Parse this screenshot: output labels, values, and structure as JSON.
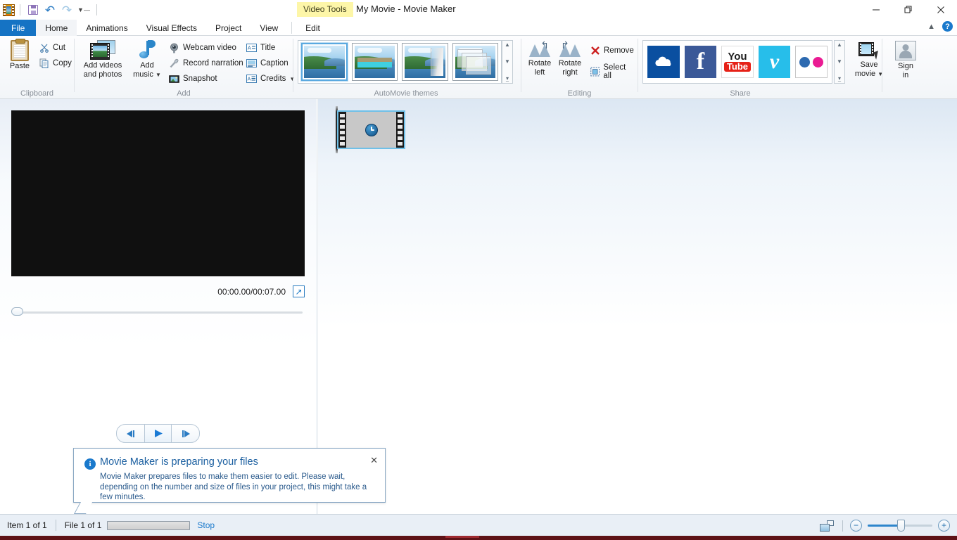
{
  "window": {
    "title": "My Movie - Movie Maker",
    "contextual_tab_label": "Video Tools",
    "minimize_icon": "minimize-icon",
    "maximize_icon": "restore-icon",
    "close_icon": "close-icon"
  },
  "quick_access": {
    "app_icon": "movie-maker-icon",
    "save_icon": "save-icon",
    "undo_icon": "undo-icon",
    "redo_icon": "redo-icon",
    "customize_icon": "chevron-down-icon"
  },
  "tabs": [
    {
      "label": "File",
      "state": "file"
    },
    {
      "label": "Home",
      "state": "active"
    },
    {
      "label": "Animations",
      "state": "normal"
    },
    {
      "label": "Visual Effects",
      "state": "normal"
    },
    {
      "label": "Project",
      "state": "normal"
    },
    {
      "label": "View",
      "state": "normal"
    },
    {
      "label": "Edit",
      "state": "contextual"
    }
  ],
  "ribbon_right": {
    "collapse_icon": "chevron-up-icon",
    "help_label": "?"
  },
  "ribbon": {
    "groups": [
      {
        "name": "Clipboard",
        "label": "Clipboard",
        "paste": {
          "label": "Paste",
          "icon": "paste-clipboard-icon"
        },
        "items": [
          {
            "label": "Cut",
            "icon": "cut-scissors-icon"
          },
          {
            "label": "Copy",
            "icon": "copy-icon"
          }
        ]
      },
      {
        "name": "Add",
        "label": "Add",
        "big_buttons": [
          {
            "label_line1": "Add videos",
            "label_line2": "and photos",
            "icon": "add-videos-and-photos-icon"
          },
          {
            "label_line1": "Add",
            "label_line2": "music",
            "icon": "add-music-icon",
            "has_dropdown": true
          }
        ],
        "small_items": [
          {
            "label": "Webcam video",
            "icon": "webcam-icon",
            "has_dropdown": false
          },
          {
            "label": "Record narration",
            "icon": "microphone-icon",
            "has_dropdown": true
          },
          {
            "label": "Snapshot",
            "icon": "snapshot-icon",
            "has_dropdown": false
          },
          {
            "label": "Title",
            "icon": "title-icon",
            "has_dropdown": false
          },
          {
            "label": "Caption",
            "icon": "caption-icon",
            "has_dropdown": false
          },
          {
            "label": "Credits",
            "icon": "credits-icon",
            "has_dropdown": true
          }
        ]
      },
      {
        "name": "AutoMovie themes",
        "label": "AutoMovie themes",
        "themes": [
          {
            "name": "no-theme",
            "selected": true
          },
          {
            "name": "contemporary-theme",
            "selected": false
          },
          {
            "name": "cinematic-theme",
            "selected": false
          },
          {
            "name": "fade-theme",
            "selected": false
          }
        ],
        "scroll": {
          "up_icon": "scroll-up-icon",
          "down_icon": "scroll-down-icon",
          "more_icon": "gallery-more-icon"
        }
      },
      {
        "name": "Editing",
        "label": "Editing",
        "rotate_left": {
          "label_line1": "Rotate",
          "label_line2": "left",
          "icon": "rotate-left-icon"
        },
        "rotate_right": {
          "label_line1": "Rotate",
          "label_line2": "right",
          "icon": "rotate-right-icon"
        },
        "items": [
          {
            "label": "Remove",
            "icon": "remove-x-icon"
          },
          {
            "label": "Select all",
            "icon": "select-all-icon"
          }
        ]
      },
      {
        "name": "Share",
        "label": "Share",
        "services": [
          {
            "name": "onedrive",
            "icon": "onedrive-icon"
          },
          {
            "name": "facebook",
            "icon": "facebook-icon",
            "glyph": "f"
          },
          {
            "name": "youtube",
            "icon": "youtube-icon",
            "glyph_top": "You",
            "glyph_bottom": "Tube"
          },
          {
            "name": "vimeo",
            "icon": "vimeo-icon",
            "glyph": "v"
          },
          {
            "name": "flickr",
            "icon": "flickr-icon"
          }
        ],
        "save_movie": {
          "label_line1": "Save",
          "label_line2": "movie",
          "icon": "save-movie-icon",
          "has_dropdown": true
        },
        "sign_in": {
          "label_line1": "Sign",
          "label_line2": "in",
          "icon": "sign-in-person-icon"
        }
      }
    ]
  },
  "preview": {
    "time_display": "00:00.00/00:07.00",
    "fullscreen_icon": "fullscreen-arrow-icon",
    "seek_position_percent": 0,
    "transport": [
      {
        "name": "previous-frame",
        "icon": "previous-frame-icon"
      },
      {
        "name": "play",
        "icon": "play-icon"
      },
      {
        "name": "next-frame",
        "icon": "next-frame-icon"
      }
    ]
  },
  "storyboard": {
    "clips": [
      {
        "name": "clip-1",
        "state": "loading",
        "icon": "clock-icon",
        "selected": true
      }
    ]
  },
  "notification": {
    "icon": "info-icon",
    "title": "Movie Maker is preparing your files",
    "body": "Movie Maker prepares files to make them easier to edit. Please wait, depending on the number and size of files in your project, this might take a few minutes.",
    "close_label": "✕"
  },
  "status_bar": {
    "item_count": "Item 1 of 1",
    "file_count": "File 1 of 1",
    "progress_percent": 0,
    "stop_label": "Stop",
    "view_icon": "storyboard-view-icon",
    "zoom_out_label": "−",
    "zoom_in_label": "+",
    "zoom_value_percent": 47
  },
  "colors": {
    "accent_blue": "#1573c4",
    "file_tab": "#1573c4",
    "contextual_tab_bg": "#fdf6a8",
    "link_blue": "#1a79cc",
    "notification_text": "#2a5a8c",
    "selection_outline": "#6fc0e8"
  }
}
